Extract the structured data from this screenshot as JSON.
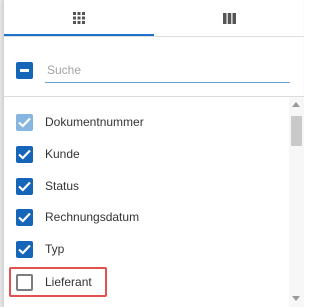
{
  "tabs": [
    {
      "name": "filter",
      "icon": "grid-icon",
      "active": true
    },
    {
      "name": "columns",
      "icon": "columns-icon",
      "active": false
    }
  ],
  "accent_color": "#1e73c8",
  "search": {
    "placeholder": "Suche",
    "value": ""
  },
  "columns": [
    {
      "label": "Dokumentnummer",
      "checked": true,
      "disabled": true
    },
    {
      "label": "Kunde",
      "checked": true
    },
    {
      "label": "Status",
      "checked": true
    },
    {
      "label": "Rechnungsdatum",
      "checked": true
    },
    {
      "label": "Typ",
      "checked": true
    },
    {
      "label": "Lieferant",
      "checked": false,
      "highlighted": true
    }
  ],
  "highlight_color": "#e2514c"
}
